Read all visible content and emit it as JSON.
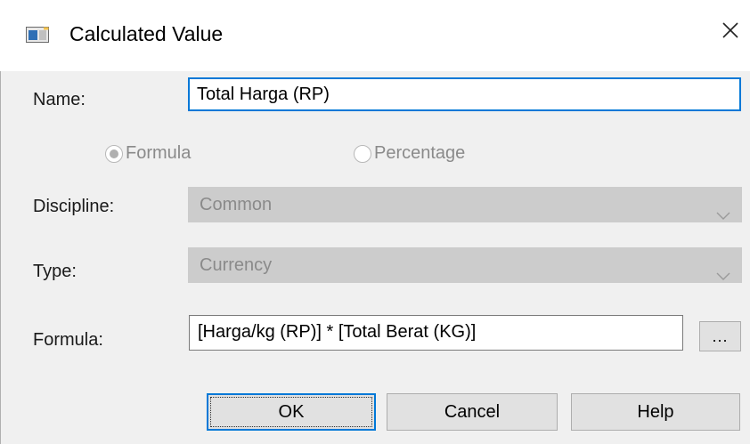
{
  "window": {
    "title": "Calculated Value",
    "app_icon": "window-icon",
    "close_icon": "close-icon"
  },
  "form": {
    "name_label": "Name:",
    "name_value": "Total Harga (RP)",
    "radio_formula_label": "Formula",
    "radio_formula_selected": true,
    "radio_percentage_label": "Percentage",
    "radio_percentage_selected": false,
    "discipline_label": "Discipline:",
    "discipline_value": "Common",
    "type_label": "Type:",
    "type_value": "Currency",
    "formula_label": "Formula:",
    "formula_value": "[Harga/kg (RP)] * [Total Berat (KG)]",
    "formula_browse_label": "..."
  },
  "buttons": {
    "ok_label": "OK",
    "cancel_label": "Cancel",
    "help_label": "Help"
  },
  "colors": {
    "accent": "#0078d7",
    "panel": "#f0f0f0",
    "disabled_field": "#cccccc",
    "disabled_text": "#8a8a8a"
  }
}
